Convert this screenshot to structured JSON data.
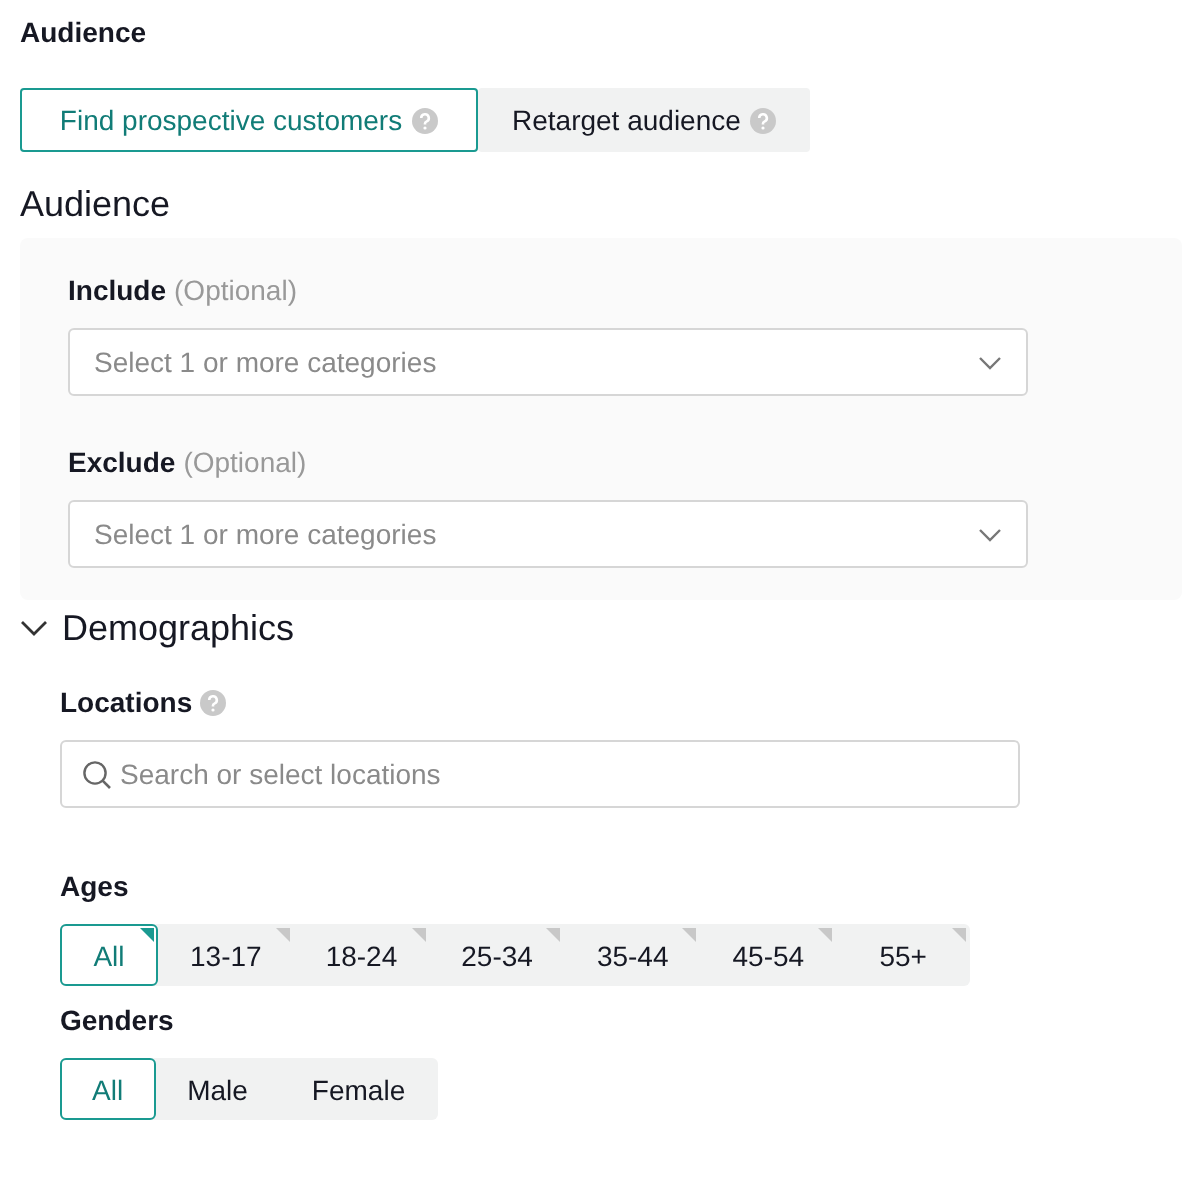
{
  "section_label": "Audience",
  "audience_tabs": [
    {
      "label": "Find prospective customers",
      "selected": true
    },
    {
      "label": "Retarget audience",
      "selected": false
    }
  ],
  "audience_heading": "Audience",
  "category_fields": [
    {
      "label": "Include",
      "hint": "(Optional)",
      "placeholder": "Select 1 or more categories"
    },
    {
      "label": "Exclude",
      "hint": "(Optional)",
      "placeholder": "Select 1 or more categories"
    }
  ],
  "demographics": {
    "title": "Demographics",
    "expanded": true,
    "locations": {
      "label": "Locations",
      "placeholder": "Search or select locations"
    },
    "ages": {
      "label": "Ages",
      "options": [
        {
          "label": "All",
          "selected": true
        },
        {
          "label": "13-17",
          "selected": false
        },
        {
          "label": "18-24",
          "selected": false
        },
        {
          "label": "25-34",
          "selected": false
        },
        {
          "label": "35-44",
          "selected": false
        },
        {
          "label": "45-54",
          "selected": false
        },
        {
          "label": "55+",
          "selected": false
        }
      ]
    },
    "genders": {
      "label": "Genders",
      "options": [
        {
          "label": "All",
          "selected": true
        },
        {
          "label": "Male",
          "selected": false
        },
        {
          "label": "Female",
          "selected": false
        }
      ]
    }
  }
}
